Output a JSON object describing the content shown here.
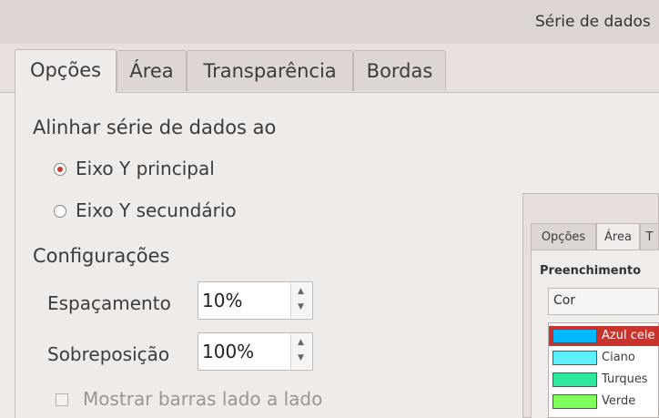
{
  "window": {
    "title": "Série de dados"
  },
  "tabs": [
    {
      "label": "Opções",
      "active": true
    },
    {
      "label": "Área"
    },
    {
      "label": "Transparência"
    },
    {
      "label": "Bordas"
    }
  ],
  "align": {
    "heading": "Alinhar série de dados ao",
    "primary": {
      "label": "Eixo Y principal",
      "checked": true
    },
    "secondary": {
      "label": "Eixo Y secundário",
      "checked": false
    }
  },
  "settings": {
    "heading": "Configurações",
    "spacing_label": "Espaçamento",
    "spacing_value": "10%",
    "overlap_label": "Sobreposição",
    "overlap_value": "100%",
    "side_by_side_label": "Mostrar barras lado a lado"
  },
  "preview": {
    "tabs": [
      "Opções",
      "Área",
      "T"
    ],
    "fill_heading": "Preenchimento",
    "fill_type": "Cor",
    "colors": [
      {
        "name": "Azul cele",
        "color": "#00b8ff",
        "selected": true
      },
      {
        "name": "Ciano",
        "color": "#5cf0ff"
      },
      {
        "name": "Turques",
        "color": "#2fe8a0"
      },
      {
        "name": "Verde",
        "color": "#7fff5c"
      }
    ]
  }
}
